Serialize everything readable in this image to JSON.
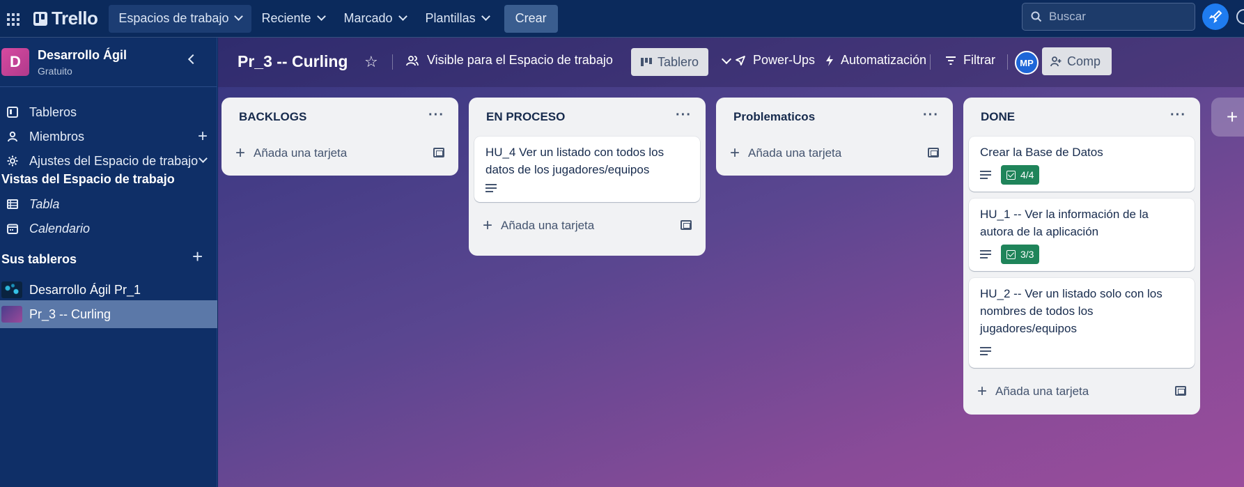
{
  "topbar": {
    "logo": "Trello",
    "nav": [
      {
        "label": "Espacios de trabajo"
      },
      {
        "label": "Reciente"
      },
      {
        "label": "Marcado"
      },
      {
        "label": "Plantillas"
      }
    ],
    "create_label": "Crear",
    "search_placeholder": "Buscar"
  },
  "sidebar": {
    "workspace_initial": "D",
    "workspace_name": "Desarrollo Ágil",
    "workspace_plan": "Gratuito",
    "items": [
      {
        "label": "Tableros"
      },
      {
        "label": "Miembros"
      },
      {
        "label": "Ajustes del Espacio de trabajo"
      }
    ],
    "views_title": "Vistas del Espacio de trabajo",
    "views": [
      {
        "label": "Tabla"
      },
      {
        "label": "Calendario"
      }
    ],
    "boards_title": "Sus tableros",
    "boards": [
      {
        "label": "Desarrollo Ágil Pr_1"
      },
      {
        "label": "Pr_3 -- Curling"
      }
    ]
  },
  "board": {
    "title": "Pr_3 -- Curling",
    "visibility": "Visible para el Espacio de trabajo",
    "view_label": "Tablero",
    "powerups": "Power-Ups",
    "automation": "Automatización",
    "filter": "Filtrar",
    "member_initials": "MP",
    "share": "Comp",
    "add_card_label": "Añada una tarjeta",
    "lists": [
      {
        "title": "BACKLOGS",
        "cards": []
      },
      {
        "title": "EN PROCESO",
        "cards": [
          {
            "title": "HU_4 Ver un listado con todos los datos de los jugadores/equipos"
          }
        ]
      },
      {
        "title": "Problematicos",
        "cards": []
      },
      {
        "title": "DONE",
        "cards": [
          {
            "title": "Crear la Base de Datos",
            "checklist": "4/4"
          },
          {
            "title": "HU_1 -- Ver la información de la autora de la aplicación",
            "checklist": "3/3"
          },
          {
            "title": "HU_2 -- Ver un listado solo con los nombres de todos los jugadores/equipos"
          }
        ]
      }
    ]
  },
  "colors": {
    "topbar": "#0b2a5c",
    "sidebar": "#0f2f67",
    "checklist_badge": "#1f845a",
    "selected_board": "#5b78a8"
  }
}
